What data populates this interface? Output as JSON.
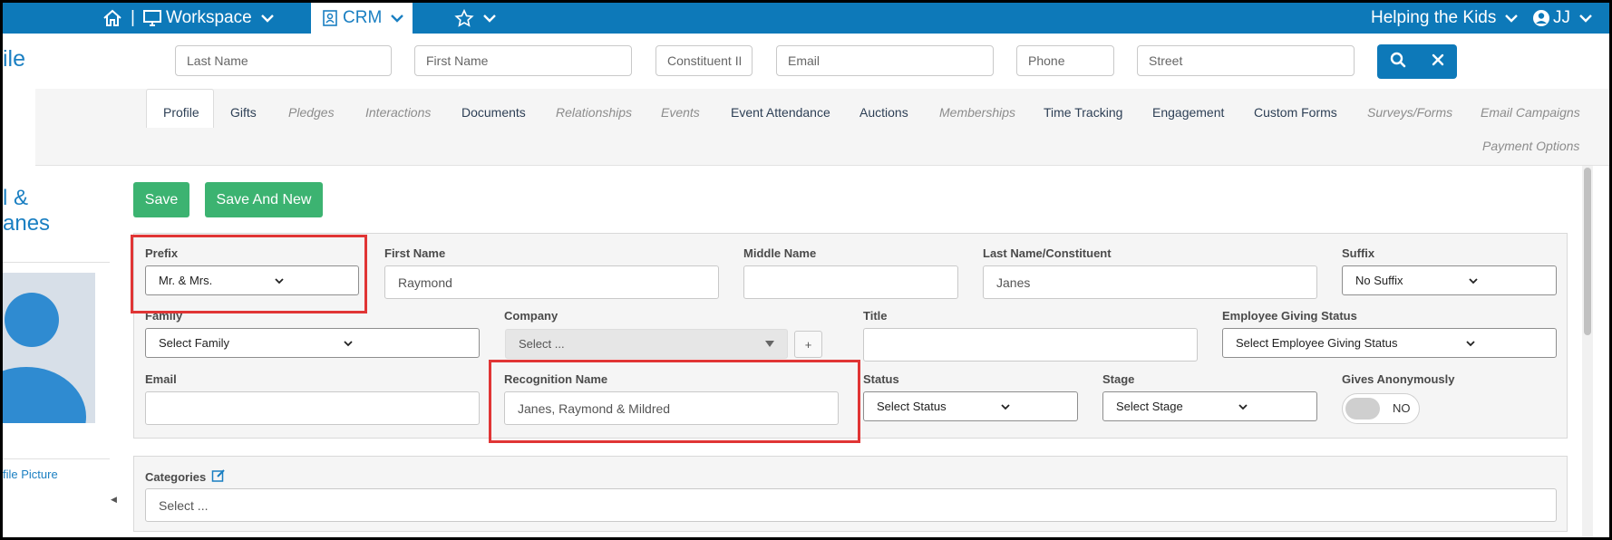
{
  "header": {
    "workspace_label": "Workspace",
    "crm_label": "CRM",
    "org_name": "Helping the Kids",
    "user_initials": "JJ"
  },
  "search": {
    "last_name_placeholder": "Last Name",
    "first_name_placeholder": "First Name",
    "constituent_id_placeholder": "Constituent ID",
    "email_placeholder": "Email",
    "phone_placeholder": "Phone",
    "street_placeholder": "Street"
  },
  "sidebar": {
    "page_title_fragment": "ile",
    "name_line1": "l &",
    "name_line2": "anes",
    "profile_picture_link": "file Picture"
  },
  "tabs": [
    {
      "label": "Profile",
      "enabled": true
    },
    {
      "label": "Gifts",
      "enabled": true
    },
    {
      "label": "Pledges",
      "enabled": false
    },
    {
      "label": "Interactions",
      "enabled": false
    },
    {
      "label": "Documents",
      "enabled": true
    },
    {
      "label": "Relationships",
      "enabled": false
    },
    {
      "label": "Events",
      "enabled": false
    },
    {
      "label": "Event Attendance",
      "enabled": true
    },
    {
      "label": "Auctions",
      "enabled": true
    },
    {
      "label": "Memberships",
      "enabled": false
    },
    {
      "label": "Time Tracking",
      "enabled": true
    },
    {
      "label": "Engagement",
      "enabled": true
    },
    {
      "label": "Custom Forms",
      "enabled": true
    },
    {
      "label": "Surveys/Forms",
      "enabled": false
    },
    {
      "label": "Email Campaigns",
      "enabled": false
    },
    {
      "label": "Payment Options",
      "enabled": false
    }
  ],
  "actions": {
    "save_label": "Save",
    "save_new_label": "Save And New"
  },
  "form": {
    "prefix_label": "Prefix",
    "prefix_value": "Mr. & Mrs.",
    "first_name_label": "First Name",
    "first_name_value": "Raymond",
    "middle_name_label": "Middle Name",
    "middle_name_value": "",
    "last_name_label": "Last Name/Constituent",
    "last_name_value": "Janes",
    "suffix_label": "Suffix",
    "suffix_value": "No Suffix",
    "family_label": "Family",
    "family_value": "Select Family",
    "company_label": "Company",
    "company_value": "Select ...",
    "company_add": "+",
    "title_label": "Title",
    "title_value": "",
    "employee_giving_label": "Employee Giving Status",
    "employee_giving_value": "Select Employee Giving Status",
    "email_label": "Email",
    "email_value": "",
    "recognition_label": "Recognition Name",
    "recognition_value": "Janes, Raymond & Mildred",
    "status_label": "Status",
    "status_value": "Select Status",
    "stage_label": "Stage",
    "stage_value": "Select Stage",
    "anonymous_label": "Gives Anonymously",
    "anonymous_value": "NO",
    "categories_label": "Categories",
    "categories_placeholder": "Select ..."
  },
  "colors": {
    "brand_blue": "#0d79b9",
    "save_green": "#3cb371",
    "highlight_red": "#e03535"
  }
}
